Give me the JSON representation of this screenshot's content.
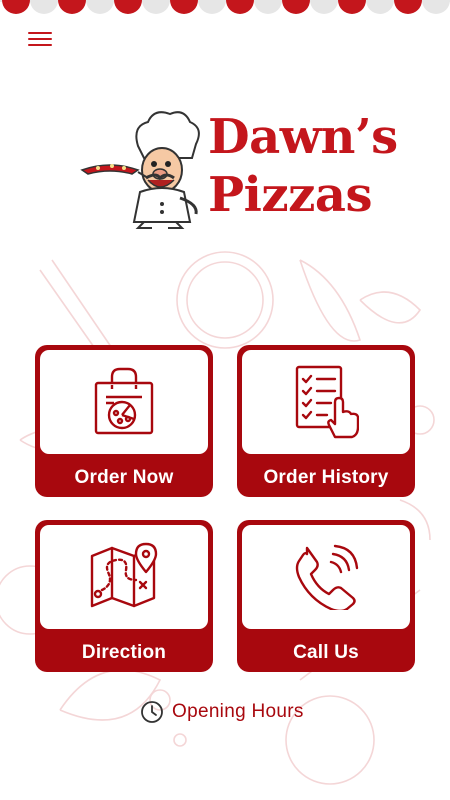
{
  "header": {
    "menu_icon": "hamburger-menu-icon"
  },
  "logo": {
    "line1": "Dawn’s",
    "line2": "Pizzas",
    "mascot_icon": "chef-with-pizza-icon"
  },
  "tiles": [
    {
      "label": "Order Now",
      "icon": "shopping-bag-pizza-icon"
    },
    {
      "label": "Order History",
      "icon": "receipt-list-icon"
    },
    {
      "label": "Direction",
      "icon": "folded-map-pin-icon"
    },
    {
      "label": "Call Us",
      "icon": "phone-call-icon"
    }
  ],
  "footer": {
    "opening_hours": "Opening Hours",
    "clock_icon": "clock-icon"
  },
  "colors": {
    "primary": "#a8080e",
    "brand_red": "#c4161c",
    "background": "#ffffff",
    "doodle": "#f4d6d7"
  }
}
